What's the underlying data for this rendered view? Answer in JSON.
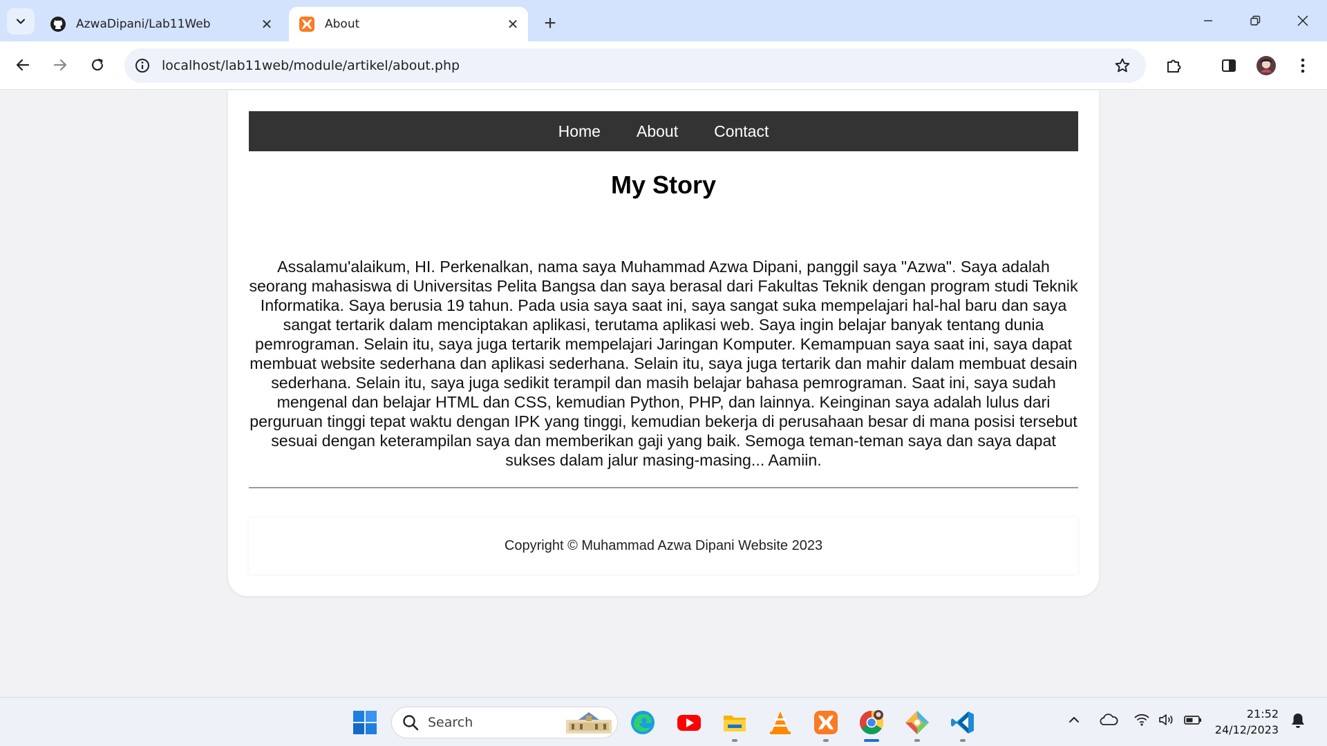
{
  "browser": {
    "tabs": [
      {
        "title": "AzwaDipani/Lab11Web",
        "icon": "github-icon",
        "active": false
      },
      {
        "title": "About",
        "icon": "xampp-icon",
        "active": true
      }
    ],
    "new_tab_label": "+",
    "url": "localhost/lab11web/module/artikel/about.php"
  },
  "page": {
    "nav": [
      {
        "label": "Home"
      },
      {
        "label": "About"
      },
      {
        "label": "Contact"
      }
    ],
    "title": "My Story",
    "story": "Assalamu'alaikum, HI. Perkenalkan, nama saya Muhammad Azwa Dipani, panggil saya \"Azwa\". Saya adalah seorang mahasiswa di Universitas Pelita Bangsa dan saya berasal dari Fakultas Teknik dengan program studi Teknik Informatika. Saya berusia 19 tahun. Pada usia saya saat ini, saya sangat suka mempelajari hal-hal baru dan saya sangat tertarik dalam menciptakan aplikasi, terutama aplikasi web. Saya ingin belajar banyak tentang dunia pemrograman. Selain itu, saya juga tertarik mempelajari Jaringan Komputer. Kemampuan saya saat ini, saya dapat membuat website sederhana dan aplikasi sederhana. Selain itu, saya juga tertarik dan mahir dalam membuat desain sederhana. Selain itu, saya juga sedikit terampil dan masih belajar bahasa pemrograman. Saat ini, saya sudah mengenal dan belajar HTML dan CSS, kemudian Python, PHP, dan lainnya. Keinginan saya adalah lulus dari perguruan tinggi tepat waktu dengan IPK yang tinggi, kemudian bekerja di perusahaan besar di mana posisi tersebut sesuai dengan keterampilan saya dan memberikan gaji yang baik. Semoga teman-teman saya dan saya dapat sukses dalam jalur masing-masing... Aamiin.",
    "footer": "Copyright © Muhammad Azwa Dipani Website 2023"
  },
  "taskbar": {
    "search_label": "Search",
    "apps": [
      "windows-start-icon",
      "edge-icon",
      "youtube-icon",
      "file-explorer-icon",
      "vlc-icon",
      "xampp-icon",
      "chrome-icon",
      "git-icon",
      "vscode-icon"
    ],
    "time": "21:52",
    "date": "24/12/2023"
  },
  "colors": {
    "tab_strip": "#d3e3fd",
    "nav_bar": "#333333",
    "page_bg": "#f2f2f4",
    "xampp_orange": "#fb7a24"
  }
}
